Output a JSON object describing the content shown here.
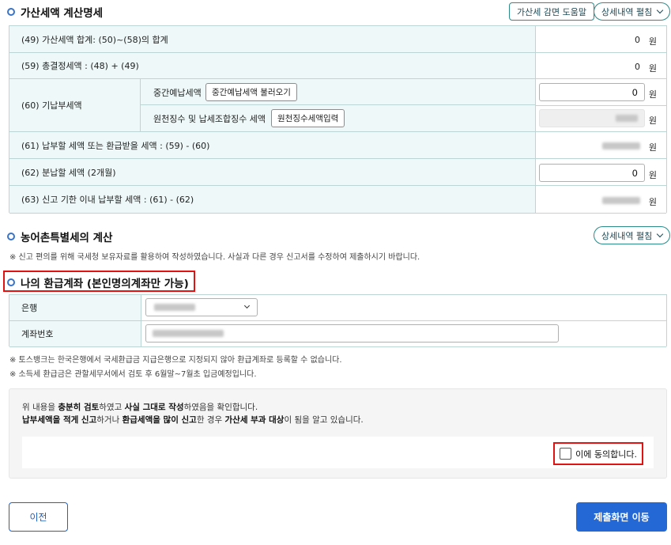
{
  "section1": {
    "title": "가산세액 계산명세",
    "help_button": "가산세 감면 도움말",
    "detail_button": "상세내역 펼침",
    "rows": {
      "r49": {
        "label": "(49) 가산세액 합계: (50)~(58)의 합계",
        "amount": "0",
        "unit": "원"
      },
      "r59": {
        "label": "(59) 총결정세액 : (48) + (49)",
        "amount": "0",
        "unit": "원"
      },
      "r60": {
        "label": "(60) 기납부세액",
        "sub1_label": "중간예납세액",
        "sub1_button": "중간예납세액 불러오기",
        "sub1_value": "0",
        "sub2_label": "원천징수 및 납세조합징수 세액",
        "sub2_button": "원천징수세액입력",
        "unit": "원"
      },
      "r61": {
        "label": "(61) 납부할 세액 또는 환급받을 세액 : (59) - (60)",
        "unit": "원"
      },
      "r62": {
        "label": "(62) 분납할 세액 (2개월)",
        "value": "0",
        "unit": "원"
      },
      "r63": {
        "label": "(63) 신고 기한 이내 납부할 세액 : (61) - (62)",
        "unit": "원"
      }
    }
  },
  "section2": {
    "title": "농어촌특별세의 계산",
    "detail_button": "상세내역 펼침",
    "note": "※ 신고 편의를 위해 국세청 보유자료를 활용하여 작성하였습니다. 사실과 다른 경우 신고서를 수정하여 제출하시기 바랍니다."
  },
  "section3": {
    "title": "나의 환급계좌 (본인명의계좌만 가능)",
    "bank_label": "은행",
    "account_label": "계좌번호",
    "notes": [
      "※ 토스뱅크는 한국은행에서 국세환급금 지급은행으로 지정되지 않아 환급계좌로 등록할 수 없습니다.",
      "※ 소득세 환급금은 관할세무서에서 검토 후 6월말~7월초 입금예정입니다."
    ]
  },
  "confirm": {
    "line1": [
      {
        "t": "위 내용을 ",
        "b": false
      },
      {
        "t": "충분히 검토",
        "b": true
      },
      {
        "t": "하였고 ",
        "b": false
      },
      {
        "t": "사실 그대로 작성",
        "b": true
      },
      {
        "t": "하였음을 확인합니다.",
        "b": false
      }
    ],
    "line2": [
      {
        "t": "납부세액을 적게 신고",
        "b": true
      },
      {
        "t": "하거나 ",
        "b": false
      },
      {
        "t": "환급세액을 많이 신고",
        "b": true
      },
      {
        "t": "한 경우 ",
        "b": false
      },
      {
        "t": "가산세 부과 대상",
        "b": true
      },
      {
        "t": "이 됨을 알고 있습니다.",
        "b": false
      }
    ],
    "agree_label": "이에 동의합니다."
  },
  "footer": {
    "prev_button": "이전",
    "next_button": "제출화면 이동"
  },
  "colors": {
    "accent_blue": "#2468d6",
    "table_label_bg": "#eef8f8",
    "highlight_red": "#e01212",
    "pill_border": "#2c8c8c"
  }
}
